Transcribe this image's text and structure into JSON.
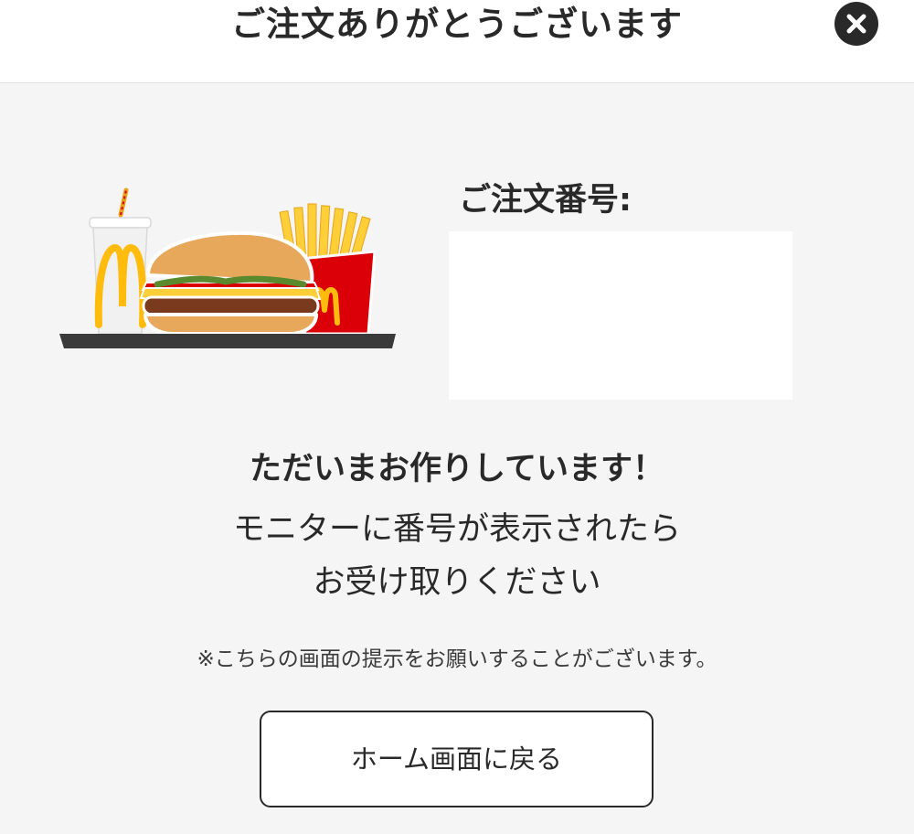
{
  "header": {
    "title": "ご注文ありがとうございます"
  },
  "order": {
    "label": "ご注文番号:",
    "number": ""
  },
  "messages": {
    "line1": "ただいまお作りしています！",
    "line2": "モニターに番号が表示されたら",
    "line3": "お受け取りください"
  },
  "note": "※こちらの画面の提示をお願いすることがございます。",
  "home_button": {
    "label": "ホーム画面に戻る"
  },
  "icons": {
    "close": "close-icon",
    "illustration": "meal-tray-illustration"
  },
  "colors": {
    "brand_yellow": "#ffbc0d",
    "brand_red": "#db0007",
    "text": "#292929",
    "background": "#f5f5f5"
  }
}
